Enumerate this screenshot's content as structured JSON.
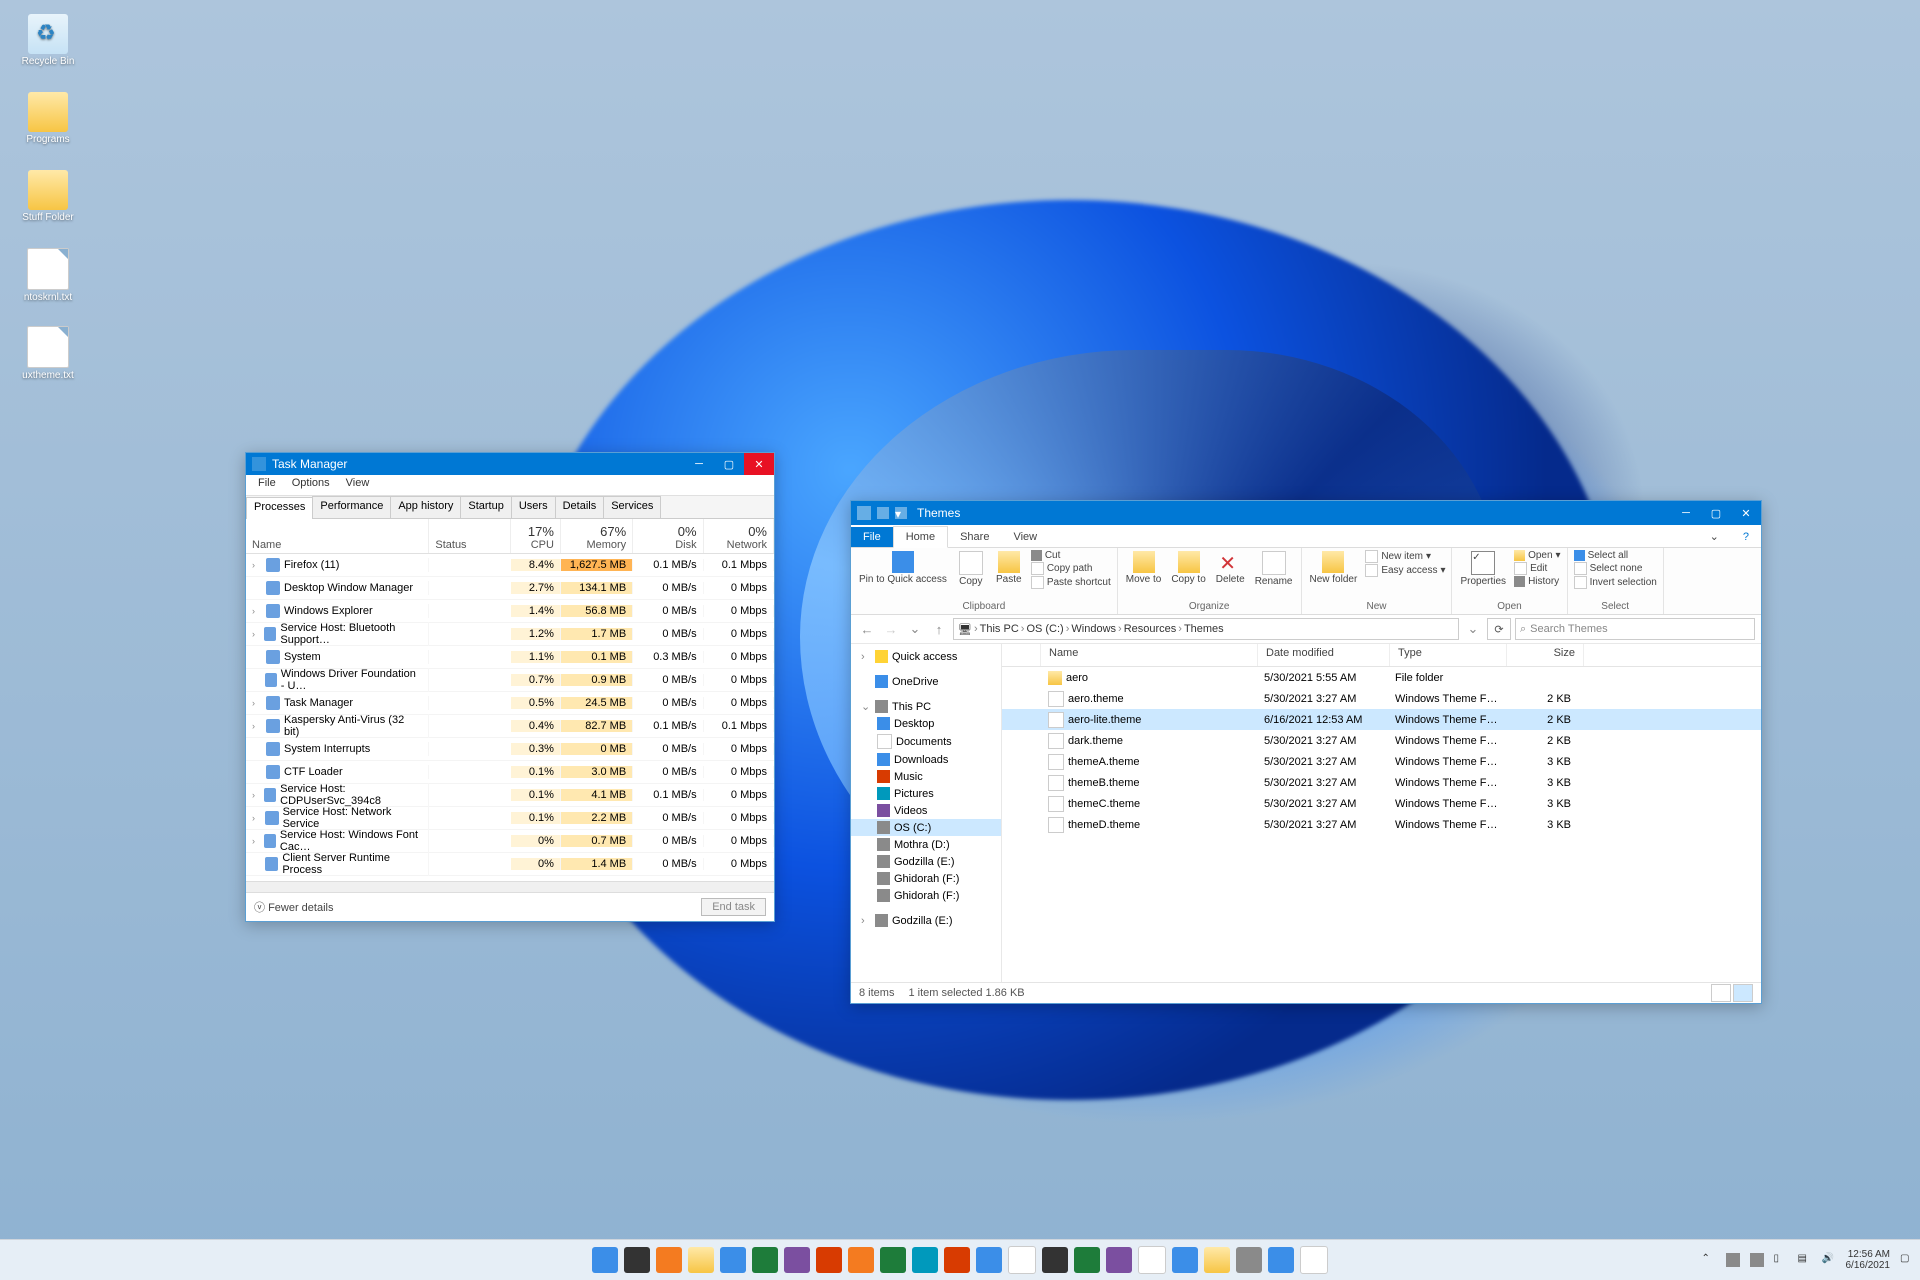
{
  "desktop_icons": [
    {
      "label": "Recycle Bin",
      "kind": "bin"
    },
    {
      "label": "Programs",
      "kind": "fld"
    },
    {
      "label": "Stuff Folder",
      "kind": "fld"
    },
    {
      "label": "ntoskrnl.txt",
      "kind": "doc"
    },
    {
      "label": "uxtheme.txt",
      "kind": "doc"
    }
  ],
  "tm": {
    "title": "Task Manager",
    "menu": [
      "File",
      "Options",
      "View"
    ],
    "tabs": [
      "Processes",
      "Performance",
      "App history",
      "Startup",
      "Users",
      "Details",
      "Services"
    ],
    "headers": {
      "name": "Name",
      "status": "Status",
      "cpu_pct": "17%",
      "cpu": "CPU",
      "mem_pct": "67%",
      "mem": "Memory",
      "disk_pct": "0%",
      "disk": "Disk",
      "net_pct": "0%",
      "net": "Network"
    },
    "rows": [
      {
        "exp": "›",
        "name": "Firefox (11)",
        "cpu": "8.4%",
        "mem": "1,627.5 MB",
        "disk": "0.1 MB/s",
        "net": "0.1 Mbps",
        "heat": 1
      },
      {
        "exp": "",
        "name": "Desktop Window Manager",
        "cpu": "2.7%",
        "mem": "134.1 MB",
        "disk": "0 MB/s",
        "net": "0 Mbps"
      },
      {
        "exp": "›",
        "name": "Windows Explorer",
        "cpu": "1.4%",
        "mem": "56.8 MB",
        "disk": "0 MB/s",
        "net": "0 Mbps"
      },
      {
        "exp": "›",
        "name": "Service Host: Bluetooth Support…",
        "cpu": "1.2%",
        "mem": "1.7 MB",
        "disk": "0 MB/s",
        "net": "0 Mbps"
      },
      {
        "exp": "",
        "name": "System",
        "cpu": "1.1%",
        "mem": "0.1 MB",
        "disk": "0.3 MB/s",
        "net": "0 Mbps"
      },
      {
        "exp": "",
        "name": "Windows Driver Foundation - U…",
        "cpu": "0.7%",
        "mem": "0.9 MB",
        "disk": "0 MB/s",
        "net": "0 Mbps"
      },
      {
        "exp": "›",
        "name": "Task Manager",
        "cpu": "0.5%",
        "mem": "24.5 MB",
        "disk": "0 MB/s",
        "net": "0 Mbps"
      },
      {
        "exp": "›",
        "name": "Kaspersky Anti-Virus (32 bit)",
        "cpu": "0.4%",
        "mem": "82.7 MB",
        "disk": "0.1 MB/s",
        "net": "0.1 Mbps"
      },
      {
        "exp": "",
        "name": "System Interrupts",
        "cpu": "0.3%",
        "mem": "0 MB",
        "disk": "0 MB/s",
        "net": "0 Mbps"
      },
      {
        "exp": "",
        "name": "CTF Loader",
        "cpu": "0.1%",
        "mem": "3.0 MB",
        "disk": "0 MB/s",
        "net": "0 Mbps"
      },
      {
        "exp": "›",
        "name": "Service Host: CDPUserSvc_394c8",
        "cpu": "0.1%",
        "mem": "4.1 MB",
        "disk": "0.1 MB/s",
        "net": "0 Mbps"
      },
      {
        "exp": "›",
        "name": "Service Host: Network Service",
        "cpu": "0.1%",
        "mem": "2.2 MB",
        "disk": "0 MB/s",
        "net": "0 Mbps"
      },
      {
        "exp": "›",
        "name": "Service Host: Windows Font Cac…",
        "cpu": "0%",
        "mem": "0.7 MB",
        "disk": "0 MB/s",
        "net": "0 Mbps"
      },
      {
        "exp": "",
        "name": "Client Server Runtime Process",
        "cpu": "0%",
        "mem": "1.4 MB",
        "disk": "0 MB/s",
        "net": "0 Mbps"
      }
    ],
    "fewer": "Fewer details",
    "endtask": "End task"
  },
  "ex": {
    "title": "Themes",
    "ribtabs": {
      "file": "File",
      "home": "Home",
      "share": "Share",
      "view": "View"
    },
    "ribbon": {
      "clipboard": {
        "pin": "Pin to Quick access",
        "copy": "Copy",
        "paste": "Paste",
        "cut": "Cut",
        "copypath": "Copy path",
        "pastesc": "Paste shortcut",
        "label": "Clipboard"
      },
      "organize": {
        "moveto": "Move to",
        "copyto": "Copy to",
        "delete": "Delete",
        "rename": "Rename",
        "label": "Organize"
      },
      "new": {
        "newfolder": "New folder",
        "newitem": "New item",
        "easy": "Easy access",
        "label": "New"
      },
      "open": {
        "props": "Properties",
        "open": "Open",
        "edit": "Edit",
        "history": "History",
        "label": "Open"
      },
      "select": {
        "all": "Select all",
        "none": "Select none",
        "invert": "Invert selection",
        "label": "Select"
      }
    },
    "crumbs": [
      "This PC",
      "OS (C:)",
      "Windows",
      "Resources",
      "Themes"
    ],
    "search_ph": "Search Themes",
    "tree": [
      {
        "t": "Quick access",
        "ic": "ic-yellow",
        "exp": "›"
      },
      {
        "sp": 1
      },
      {
        "t": "OneDrive",
        "ic": "ic-blue",
        "exp": ""
      },
      {
        "sp": 1
      },
      {
        "t": "This PC",
        "ic": "ic-gray",
        "exp": "⌄"
      },
      {
        "t": "Desktop",
        "ic": "ic-blue",
        "ind": 1
      },
      {
        "t": "Documents",
        "ic": "ic-white",
        "ind": 1
      },
      {
        "t": "Downloads",
        "ic": "ic-blue",
        "ind": 1
      },
      {
        "t": "Music",
        "ic": "ic-red",
        "ind": 1
      },
      {
        "t": "Pictures",
        "ic": "ic-teal",
        "ind": 1
      },
      {
        "t": "Videos",
        "ic": "ic-purple",
        "ind": 1
      },
      {
        "t": "OS (C:)",
        "ic": "ic-gray",
        "ind": 1,
        "sel": 1
      },
      {
        "t": "Mothra (D:)",
        "ic": "ic-gray",
        "ind": 1
      },
      {
        "t": "Godzilla (E:)",
        "ic": "ic-gray",
        "ind": 1
      },
      {
        "t": "Ghidorah (F:)",
        "ic": "ic-gray",
        "ind": 1
      },
      {
        "t": "Ghidorah (F:)",
        "ic": "ic-gray",
        "ind": 1
      },
      {
        "sp": 1
      },
      {
        "t": "Godzilla (E:)",
        "ic": "ic-gray",
        "exp": "›"
      }
    ],
    "list_hdr": {
      "name": "Name",
      "date": "Date modified",
      "type": "Type",
      "size": "Size"
    },
    "files": [
      {
        "n": "aero",
        "d": "5/30/2021 5:55 AM",
        "t": "File folder",
        "s": "",
        "ic": "ic-folder"
      },
      {
        "n": "aero.theme",
        "d": "5/30/2021 3:27 AM",
        "t": "Windows Theme F…",
        "s": "2 KB",
        "ic": "ic-white"
      },
      {
        "n": "aero-lite.theme",
        "d": "6/16/2021 12:53 AM",
        "t": "Windows Theme F…",
        "s": "2 KB",
        "ic": "ic-white",
        "sel": 1
      },
      {
        "n": "dark.theme",
        "d": "5/30/2021 3:27 AM",
        "t": "Windows Theme F…",
        "s": "2 KB",
        "ic": "ic-white"
      },
      {
        "n": "themeA.theme",
        "d": "5/30/2021 3:27 AM",
        "t": "Windows Theme F…",
        "s": "3 KB",
        "ic": "ic-white"
      },
      {
        "n": "themeB.theme",
        "d": "5/30/2021 3:27 AM",
        "t": "Windows Theme F…",
        "s": "3 KB",
        "ic": "ic-white"
      },
      {
        "n": "themeC.theme",
        "d": "5/30/2021 3:27 AM",
        "t": "Windows Theme F…",
        "s": "3 KB",
        "ic": "ic-white"
      },
      {
        "n": "themeD.theme",
        "d": "5/30/2021 3:27 AM",
        "t": "Windows Theme F…",
        "s": "3 KB",
        "ic": "ic-white"
      }
    ],
    "status": {
      "count": "8 items",
      "sel": "1 item selected  1.86 KB"
    }
  },
  "taskbar": {
    "icons": [
      "ic-blue",
      "ic-dark",
      "ic-orange",
      "ic-folder",
      "ic-blue",
      "ic-green",
      "ic-purple",
      "ic-red",
      "ic-orange",
      "ic-green",
      "ic-teal",
      "ic-red",
      "ic-blue",
      "ic-white",
      "ic-dark",
      "ic-green",
      "ic-purple",
      "ic-white",
      "ic-blue",
      "ic-folder",
      "ic-gray",
      "ic-blue",
      "ic-white"
    ],
    "time": "12:56 AM",
    "date": "6/16/2021"
  }
}
